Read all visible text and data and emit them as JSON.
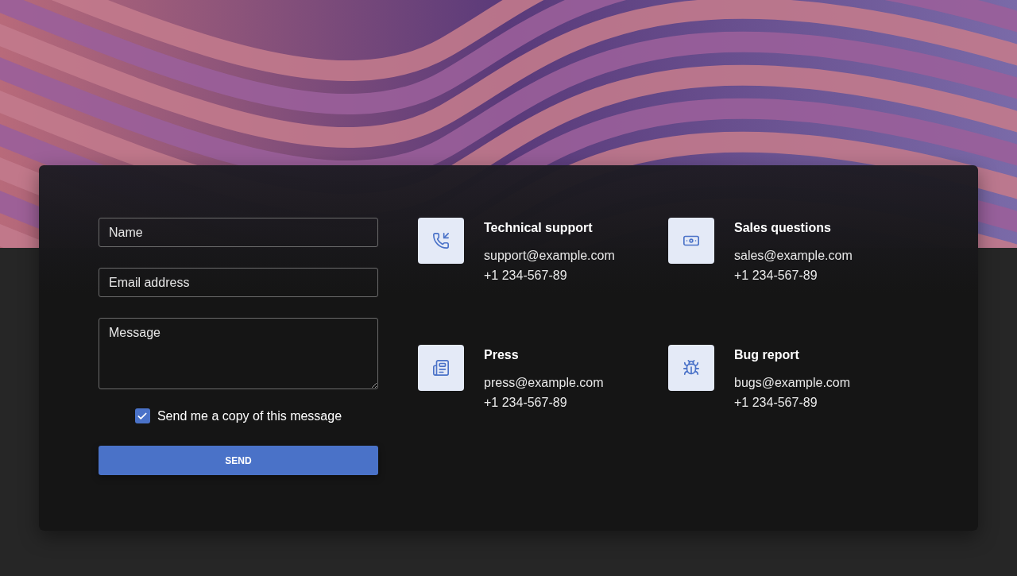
{
  "form": {
    "fields": [
      {
        "kind": "input",
        "placeholder": "Name"
      },
      {
        "kind": "input",
        "placeholder": "Email address"
      },
      {
        "kind": "textarea",
        "placeholder": "Message"
      }
    ],
    "copy_option": {
      "label": "Send me a copy of this message",
      "checked": true
    },
    "submit": "SEND"
  },
  "contacts": [
    {
      "kind": "phone",
      "title": "Technical support",
      "email": "support@example.com",
      "phone": "+1 234-567-89"
    },
    {
      "kind": "sales",
      "title": "Sales questions",
      "email": "sales@example.com",
      "phone": "+1 234-567-89"
    },
    {
      "kind": "press",
      "title": "Press",
      "email": "press@example.com",
      "phone": "+1 234-567-89"
    },
    {
      "kind": "bug",
      "title": "Bug report",
      "email": "bugs@example.com",
      "phone": "+1 234-567-89"
    }
  ]
}
